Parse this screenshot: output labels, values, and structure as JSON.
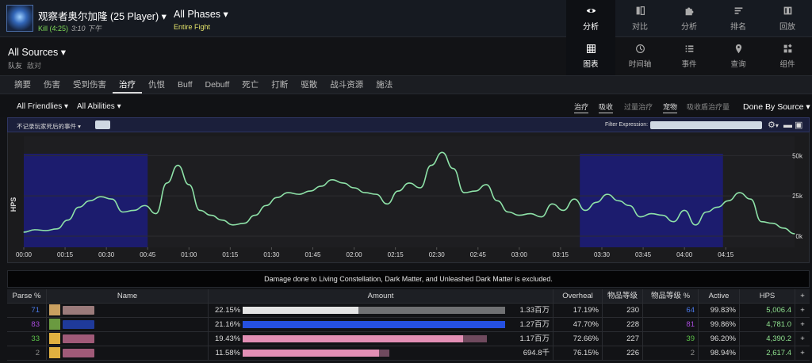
{
  "header": {
    "boss_title": "观察者奥尔加隆 (25 Player)",
    "kill": "Kill (4:25)",
    "kill_time": "3:10 下午",
    "phases": "All Phases",
    "fight": "Entire Fight",
    "nav": [
      {
        "label": "分析",
        "icon": "eye-icon",
        "active": true
      },
      {
        "label": "对比",
        "icon": "compare-icon"
      },
      {
        "label": "分析",
        "icon": "puzzle-icon"
      },
      {
        "label": "排名",
        "icon": "ranking-icon"
      },
      {
        "label": "回放",
        "icon": "replay-icon"
      }
    ]
  },
  "source": {
    "title": "All Sources",
    "tab_friendly": "队友",
    "tab_enemy": "敌对",
    "nav": [
      {
        "label": "图表",
        "icon": "grid-icon",
        "active": true
      },
      {
        "label": "时间轴",
        "icon": "clock-icon"
      },
      {
        "label": "事件",
        "icon": "list-icon"
      },
      {
        "label": "查询",
        "icon": "pin-icon"
      },
      {
        "label": "组件",
        "icon": "widgets-icon"
      }
    ]
  },
  "tabs": [
    "摘要",
    "伤害",
    "受到伤害",
    "治疗",
    "仇恨",
    "Buff",
    "Debuff",
    "死亡",
    "打断",
    "驱散",
    "战斗资源",
    "施法"
  ],
  "active_tab": "治疗",
  "filters": {
    "friendlies": "All Friendlies",
    "abilities": "All Abilities",
    "toggles": [
      {
        "label": "治疗",
        "state": "on"
      },
      {
        "label": "吸收",
        "state": "on"
      },
      {
        "label": "过量治疗",
        "state": "off"
      },
      {
        "label": "宠物",
        "state": "on"
      },
      {
        "label": "吸收盾治疗量",
        "state": "off"
      }
    ],
    "done_by": "Done By Source"
  },
  "chart_header": {
    "ignore_label": "不记录玩家死后的事件",
    "filter_label": "Filter Expression:"
  },
  "chart_data": {
    "type": "area",
    "ylabel": "HPS",
    "y_ticks": [
      "0k",
      "25k",
      "50k"
    ],
    "ylim": [
      0,
      60000
    ],
    "x_ticks": [
      "00:00",
      "00:15",
      "00:30",
      "00:45",
      "01:00",
      "01:15",
      "01:30",
      "01:45",
      "02:00",
      "02:15",
      "02:30",
      "02:45",
      "03:00",
      "03:15",
      "03:30",
      "03:45",
      "04:00",
      "04:15"
    ],
    "xlim": [
      0,
      280
    ],
    "highlight_ranges": [
      [
        0,
        45
      ],
      [
        202,
        254
      ]
    ],
    "highlight_color": "#1c1c6e",
    "line_color": "#8ee2a8",
    "series": [
      {
        "x": [
          0,
          4,
          8,
          12,
          16,
          20,
          24,
          28,
          32,
          36,
          40,
          44,
          48,
          52,
          56,
          60,
          64,
          68,
          72,
          76,
          80,
          84,
          88,
          92,
          96,
          100,
          104,
          108,
          112,
          116,
          120,
          124,
          128,
          132,
          136,
          140,
          144,
          148,
          152,
          156,
          160,
          164,
          168,
          172,
          176,
          180,
          184,
          188,
          192,
          196,
          200,
          204,
          208,
          212,
          216,
          220,
          224,
          228,
          232,
          236,
          240,
          244,
          248,
          252,
          256,
          260,
          264,
          268,
          272,
          276,
          280
        ],
        "y": [
          2500,
          4000,
          3500,
          4500,
          10000,
          18000,
          22000,
          24500,
          23000,
          15000,
          16000,
          19000,
          14000,
          33000,
          44000,
          32000,
          16000,
          13000,
          10000,
          7000,
          8000,
          13000,
          19000,
          24000,
          27000,
          26000,
          28000,
          31000,
          35000,
          33000,
          30000,
          27000,
          26000,
          20000,
          28000,
          33000,
          30000,
          44000,
          52000,
          42000,
          27000,
          28000,
          32000,
          22000,
          15000,
          13000,
          14000,
          12000,
          20000,
          16000,
          23000,
          16000,
          21000,
          26000,
          22000,
          19000,
          12000,
          14000,
          13000,
          9000,
          16000,
          7000,
          15000,
          18000,
          22000,
          27000,
          23000,
          9000,
          8000,
          5000,
          1500
        ]
      }
    ]
  },
  "note": "Damage done to Living Constellation, Dark Matter, and Unleashed Dark Matter is excluded.",
  "table": {
    "headers": [
      "Parse %",
      "Name",
      "Amount",
      "Overheal",
      "物品等级",
      "物品等级 %",
      "Active",
      "HPS",
      "+"
    ],
    "rows": [
      {
        "parse": "71",
        "parse_color": "#4a79e8",
        "pct": "22.15%",
        "fill": 0.44,
        "rest": 0.56,
        "bar_color": "#e4e4e4",
        "amount": "1.33百万",
        "overheal": "17.19%",
        "ilvl": "230",
        "ilvl_pct": "64",
        "ilvl_pct_color": "#4a79e8",
        "active": "99.83%",
        "hps": "5,006.4",
        "portrait": "#c9a060",
        "name_color": "#9a7a7a"
      },
      {
        "parse": "83",
        "parse_color": "#a64ad8",
        "pct": "21.16%",
        "fill": 1.0,
        "rest": 0.0,
        "bar_color": "#2550e0",
        "amount": "1.27百万",
        "overheal": "47.70%",
        "ilvl": "228",
        "ilvl_pct": "81",
        "ilvl_pct_color": "#a64ad8",
        "active": "99.86%",
        "hps": "4,781.0",
        "portrait": "#6a9a40",
        "name_color": "#1f3a9a"
      },
      {
        "parse": "33",
        "parse_color": "#5cc24a",
        "pct": "19.43%",
        "fill": 0.84,
        "rest": 0.09,
        "bar_color": "#e38fb5",
        "amount": "1.17百万",
        "overheal": "72.66%",
        "ilvl": "227",
        "ilvl_pct": "39",
        "ilvl_pct_color": "#5cc24a",
        "active": "96.20%",
        "hps": "4,390.2",
        "portrait": "#e0b040",
        "name_color": "#a05a78"
      },
      {
        "parse": "2",
        "parse_color": "#8d8d8d",
        "pct": "11.58%",
        "fill": 0.52,
        "rest": 0.04,
        "bar_color": "#e38fb5",
        "amount": "694.8千",
        "overheal": "76.15%",
        "ilvl": "226",
        "ilvl_pct": "2",
        "ilvl_pct_color": "#8d8d8d",
        "active": "98.94%",
        "hps": "2,617.4",
        "portrait": "#e0b040",
        "name_color": "#a05a78"
      }
    ]
  }
}
